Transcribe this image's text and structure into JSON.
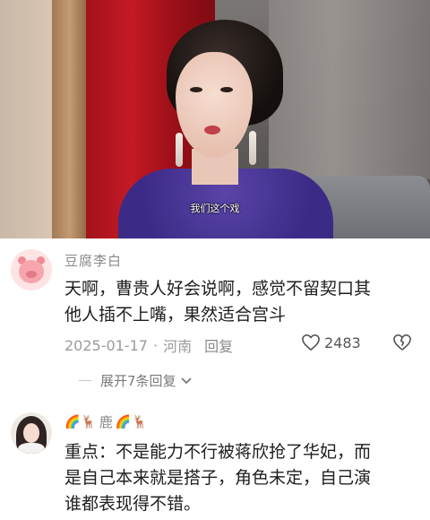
{
  "video": {
    "subtitle": "我们这个戏"
  },
  "comments": [
    {
      "username": "豆腐李白",
      "text_line1": "天啊，曹贵人好会说啊，感觉不留契口其",
      "text_line2": "他人插不上嘴，果然适合宫斗",
      "date": "2025-01-17",
      "separator": "·",
      "location": "河南",
      "reply_label": "回复",
      "likes": "2483",
      "expand_label": "展开7条回复",
      "avatar_icon": "pig-avatar"
    },
    {
      "username_prefix": "🌈🦌",
      "username": "鹿",
      "username_suffix": "🌈🦌",
      "text_line1": "重点：不是能力不行被蒋欣抢了华妃，而",
      "text_line2": "是自己本来就是搭子，角色未定，自己演",
      "text_line3": "谁都表现得不错。",
      "avatar_icon": "girl-avatar"
    }
  ],
  "colors": {
    "meta_text": "#9a9a9a",
    "body_text": "#1e1e1e",
    "username": "#8a8a8a"
  }
}
